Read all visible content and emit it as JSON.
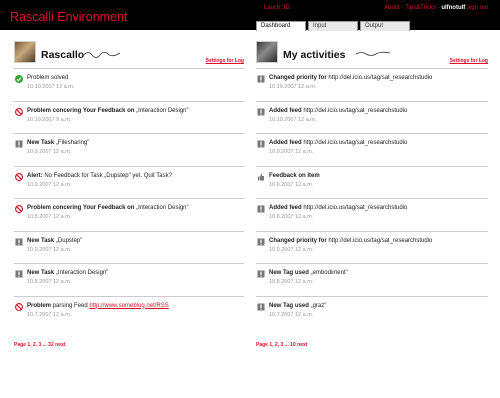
{
  "app": {
    "title": "Rascalli Environment"
  },
  "header": {
    "launch": "Lauch 3D",
    "about": "About",
    "tips": "Tips&Tricks",
    "sep": " · ",
    "user": "ulfnotulf",
    "signout": "sign out"
  },
  "tabs": [
    "Dashboard",
    "Input",
    "Output"
  ],
  "left": {
    "title": "Rascallo",
    "settings": "Settings for Log",
    "items": [
      {
        "icon": "check",
        "bold": "",
        "text": "Problem solved",
        "link": "",
        "date": "10.10.2007 12 a.m."
      },
      {
        "icon": "forbidden",
        "bold": "Problem concering Your Feedback on",
        "text": " „Interaction Design\"",
        "link": "",
        "date": "10.10.2007 9 a.m."
      },
      {
        "icon": "exclamation",
        "bold": "New Task",
        "text": " „Filesharing\"",
        "link": "",
        "date": "10.9.2007 12 a.m."
      },
      {
        "icon": "forbidden",
        "bold": "Alert:",
        "text": " No Feedback for Task „Dupstep\" yet. Quit Task?",
        "link": "",
        "date": "10.9.2007 12 a.m."
      },
      {
        "icon": "forbidden",
        "bold": "Problem concering Your Feedback on",
        "text": " „Interaction Design\"",
        "link": "",
        "date": "10.8.2007 12 a.m."
      },
      {
        "icon": "exclamation",
        "bold": "New Task",
        "text": " „Dupstep\"",
        "link": "",
        "date": "10.9.2007 12 a.m."
      },
      {
        "icon": "exclamation",
        "bold": "New Task",
        "text": " „Interaction Design\"",
        "link": "",
        "date": "10.8.2007 12 a.m."
      },
      {
        "icon": "forbidden",
        "bold": "Problem",
        "text": " parsing Feed ",
        "link": "http://www.someblog.net/RSS",
        "date": "10.7.2007 12 a.m."
      }
    ],
    "pager": "Page 1, 2, 3 ... 32  next"
  },
  "right": {
    "title": "My activities",
    "settings": "Settings for Log",
    "items": [
      {
        "icon": "exclamation",
        "bold": "Changed priority for",
        "text": " http://del.icio.us/tag/sat_researchstudio",
        "link": "",
        "date": "10.10.2007 12 a.m."
      },
      {
        "icon": "exclamation",
        "bold": "Added feed",
        "text": " http://del.icio.us/tag/sat_researchstudio",
        "link": "",
        "date": "10.10.2007 12 a.m."
      },
      {
        "icon": "exclamation",
        "bold": "Added feed",
        "text": " http://del.icio.us/tag/sat_researchstudio",
        "link": "",
        "date": "10.9.2007 12 a.m."
      },
      {
        "icon": "thumb",
        "bold": "Feedback on Item",
        "text": "",
        "link": "",
        "date": "10.9.2007 12 a.m."
      },
      {
        "icon": "exclamation",
        "bold": "Added feed",
        "text": " http://del.icio.us/tag/sat_researchstudio",
        "link": "",
        "date": "10.8.2007 12 a.m."
      },
      {
        "icon": "exclamation",
        "bold": "Changed priority for",
        "text": " http://del.icio.us/tag/sat_researchstudio",
        "link": "",
        "date": "10.9.2007 12 a.m."
      },
      {
        "icon": "exclamation",
        "bold": "New Tag used",
        "text": " „embodiment\"",
        "link": "",
        "date": "10.8.2007 12 a.m."
      },
      {
        "icon": "exclamation",
        "bold": "New Tag used",
        "text": " „graz\"",
        "link": "",
        "date": "10.7.2007 12 a.m."
      }
    ],
    "pager": "Page 1, 2, 3 ... 10  next"
  },
  "colors": {
    "accent": "#e0102b",
    "topbar": "#000000"
  }
}
